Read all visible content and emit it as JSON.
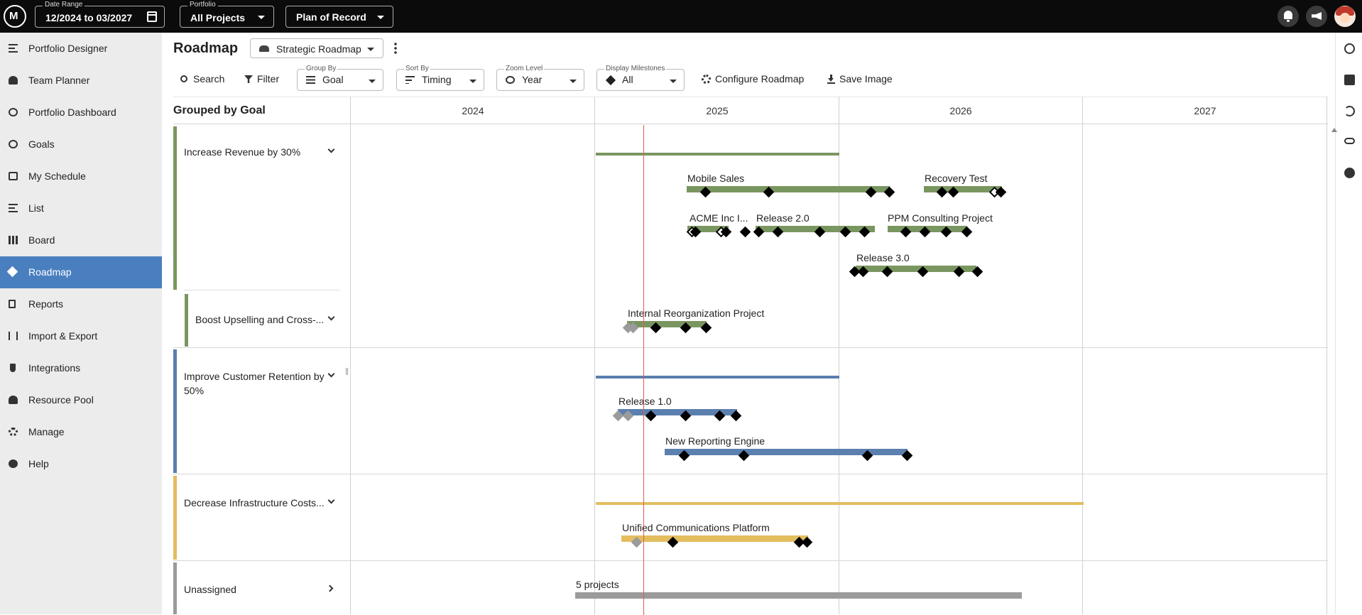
{
  "topbar": {
    "date_range_label": "Date Range",
    "date_range_value": "12/2024 to 03/2027",
    "portfolio_label": "Portfolio",
    "portfolio_value": "All Projects",
    "plan_value": "Plan of Record"
  },
  "sidebar": {
    "items": [
      {
        "label": "Portfolio Designer",
        "icon": "lines-icon"
      },
      {
        "label": "Team Planner",
        "icon": "people-icon"
      },
      {
        "label": "Portfolio Dashboard",
        "icon": "dashboard-icon"
      },
      {
        "label": "Goals",
        "icon": "target-icon"
      },
      {
        "label": "My Schedule",
        "icon": "person-badge-icon"
      },
      {
        "label": "List",
        "icon": "list-icon"
      },
      {
        "label": "Board",
        "icon": "board-icon"
      },
      {
        "label": "Roadmap",
        "icon": "roadmap-icon",
        "active": true
      },
      {
        "label": "Reports",
        "icon": "document-icon"
      },
      {
        "label": "Import & Export",
        "icon": "arrows-icon"
      },
      {
        "label": "Integrations",
        "icon": "plug-icon"
      },
      {
        "label": "Resource Pool",
        "icon": "people-icon"
      },
      {
        "label": "Manage",
        "icon": "gear-icon"
      },
      {
        "label": "Help",
        "icon": "help-icon"
      }
    ]
  },
  "header": {
    "title": "Roadmap",
    "view": "Strategic Roadmap"
  },
  "toolbar": {
    "search": "Search",
    "filter": "Filter",
    "group_by_label": "Group By",
    "group_by_value": "Goal",
    "sort_by_label": "Sort By",
    "sort_by_value": "Timing",
    "zoom_label": "Zoom Level",
    "zoom_value": "Year",
    "milestones_label": "Display Milestones",
    "milestones_value": "All",
    "configure": "Configure Roadmap",
    "save_image": "Save Image"
  },
  "grid": {
    "grouped_title": "Grouped by Goal",
    "years": [
      "2024",
      "2025",
      "2026",
      "2027"
    ]
  },
  "groups": [
    {
      "label": "Increase Revenue by 30%",
      "color": "#7a9660"
    },
    {
      "label": "Boost Upselling and Cross-...",
      "color": "#7a9660"
    },
    {
      "label": "Improve Customer Retention by 50%",
      "color": "#5b7fae"
    },
    {
      "label": "Decrease Infrastructure Costs...",
      "color": "#e3bd5e"
    },
    {
      "label": "Unassigned",
      "color": "#9b9b9b"
    }
  ],
  "projects": {
    "mobile_sales": "Mobile Sales",
    "recovery_test": "Recovery Test",
    "acme": "ACME Inc I...",
    "release_2": "Release 2.0",
    "ppm": "PPM Consulting Project",
    "release_3": "Release 3.0",
    "internal_reorg": "Internal Reorganization Project",
    "release_1": "Release 1.0",
    "new_reporting": "New Reporting Engine",
    "unified": "Unified Communications Platform",
    "unassigned_count": "5 projects"
  }
}
